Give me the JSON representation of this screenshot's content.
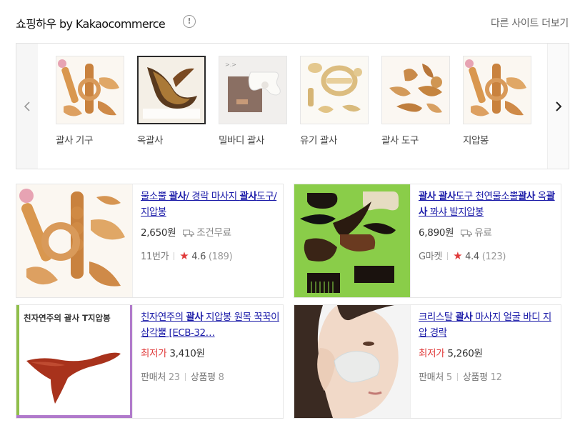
{
  "header": {
    "title": "쇼핑하우 by Kakaocommerce",
    "info_icon": "info-icon",
    "more_link": "다른 사이트 더보기"
  },
  "carousel": {
    "prev_icon": "chevron-left-icon",
    "next_icon": "chevron-right-icon",
    "items": [
      {
        "label": "괄사 기구",
        "selected": false
      },
      {
        "label": "옥괄사",
        "selected": true
      },
      {
        "label": "밀바디 괄사",
        "selected": false
      },
      {
        "label": "유기 괄사",
        "selected": false
      },
      {
        "label": "괄사 도구",
        "selected": false
      },
      {
        "label": "지압봉",
        "selected": false
      }
    ]
  },
  "products": [
    {
      "name_parts": [
        "물소뿔 ",
        "괄사",
        "/ 경락 마사지 ",
        "괄사",
        "도구/ 지압봉"
      ],
      "price": "2,650원",
      "shipping": "조건무료",
      "seller": "11번가",
      "rating": "4.6",
      "review_count": "(189)"
    },
    {
      "name_parts": [
        "",
        "괄사 괄사",
        "도구 천연물소뿔",
        "괄사",
        " 옥",
        "괄사",
        " 꽈샤 발지압봉"
      ],
      "price": "6,890원",
      "shipping": "유료",
      "seller": "G마켓",
      "rating": "4.4",
      "review_count": "(123)"
    },
    {
      "name_parts": [
        "친자연주의 ",
        "괄사",
        " 지압봉 원목 꾹꾹이 삼각뿔 [ECB-32…"
      ],
      "image_text": "친자연주의 괄사 T지압봉",
      "low_label": "최저가",
      "price": "3,410원",
      "sellers_label": "판매처",
      "sellers_count": "23",
      "reviews_label": "상품평",
      "reviews_count": "8"
    },
    {
      "name_parts": [
        "크리스탈 ",
        "괄사",
        " 마사지 얼굴 바디 지압 경락"
      ],
      "low_label": "최저가",
      "price": "5,260원",
      "sellers_label": "판매처",
      "sellers_count": "5",
      "reviews_label": "상품평",
      "reviews_count": "12"
    }
  ],
  "colors": {
    "link": "#1a1aa8",
    "accent_red": "#e03a3a"
  }
}
